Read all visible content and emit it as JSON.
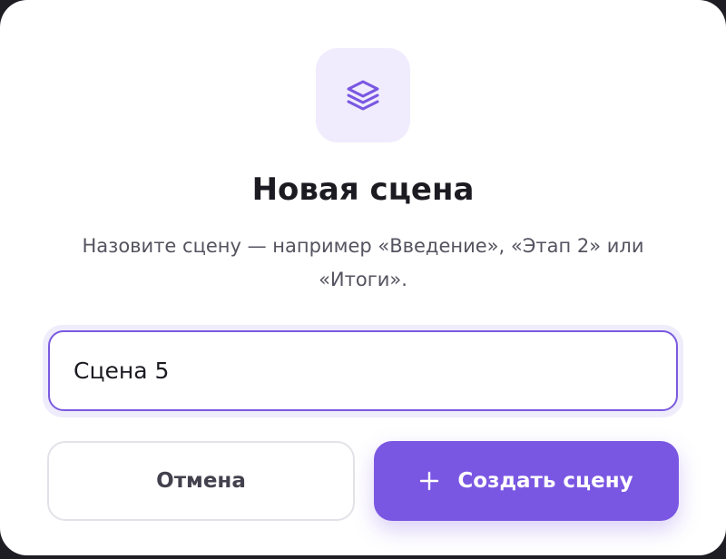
{
  "dialog": {
    "icon": "layers-icon",
    "title": "Новая сцена",
    "description": "Назовите сцену — например «Введение», «Этап 2» или «Итоги».",
    "input": {
      "value": "Сцена 5"
    },
    "cancel_label": "Отмена",
    "create_label": "Создать сцену",
    "create_icon": "plus-icon"
  },
  "colors": {
    "accent": "#7a57e2",
    "icon_tile_bg": "#f0ecfd",
    "title": "#1c1b22",
    "description": "#55535f"
  }
}
